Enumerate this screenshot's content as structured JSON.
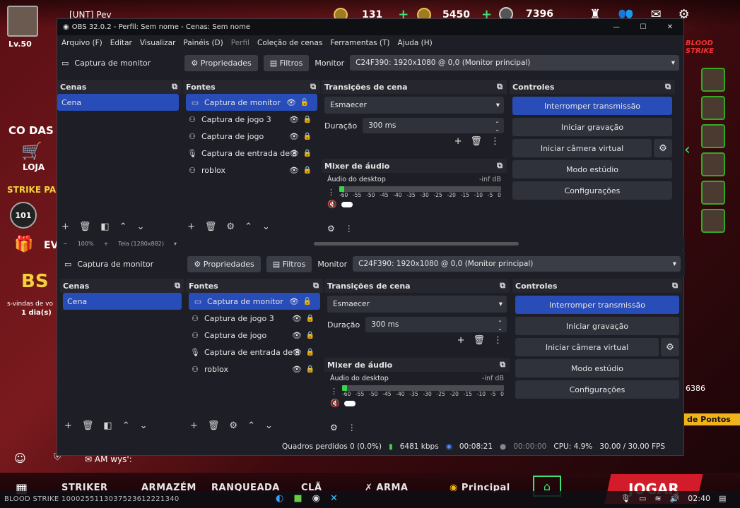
{
  "game": {
    "player_name": "[UNT] Pev",
    "level": "Lv.50",
    "stat1": "131",
    "stat2": "5450",
    "stat3": "7396",
    "left_labels": [
      "CO DAS",
      "LOJA",
      "STRIKE PA",
      "101",
      "EV"
    ],
    "event_text_1": "s-vindas de vo",
    "event_text_2": "1 dia(s)",
    "right_num": "6386",
    "right_points": "de Pontos",
    "blood_strikes_logo": "BLOOD STRIKE",
    "bottom_nav": [
      "STRIKER",
      "ARMAZÉM",
      "RANQUEADA",
      "CLÃ",
      "ARMA",
      "Principal"
    ],
    "jogar": "JOGAR",
    "uid_text": "BLOOD STRIKE 1000255113037523612221340",
    "chat_preview": "AM wys':",
    "clock": "02:40",
    "accent_red": "#d31c2a"
  },
  "obs": {
    "title": "OBS 32.0.2 - Perfil: Sem nome - Cenas: Sem nome",
    "menu": [
      "Arquivo (F)",
      "Editar",
      "Visualizar",
      "Painéis (D)",
      "Perfil",
      "Coleção de cenas",
      "Ferramentas (T)",
      "Ajuda (H)"
    ],
    "source_label": "Captura de monitor",
    "properties_btn": "Propriedades",
    "filters_btn": "Filtros",
    "monitor_label": "Monitor",
    "monitor_value": "C24F390: 1920x1080 @ 0,0 (Monitor principal)",
    "zoom_text": "100%",
    "canvas_text": "Tela (1280x882)",
    "scenes": {
      "title": "Cenas",
      "items": [
        "Cena"
      ]
    },
    "sources": {
      "title": "Fontes",
      "items": [
        "Captura de monitor",
        "Captura de jogo 3",
        "Captura de jogo",
        "Captura de entrada de á",
        "roblox"
      ]
    },
    "transitions": {
      "title": "Transições de cena",
      "type": "Esmaecer",
      "duration_label": "Duração",
      "duration_value": "300 ms"
    },
    "mixer": {
      "title": "Mixer de áudio",
      "channel": "Áudio do desktop",
      "level": "-inf dB",
      "ticks": [
        "-60",
        "-55",
        "-50",
        "-45",
        "-40",
        "-35",
        "-30",
        "-25",
        "-20",
        "-15",
        "-10",
        "-5",
        "0"
      ]
    },
    "controls": {
      "title": "Controles",
      "buttons": [
        "Interromper transmissão",
        "Iniciar gravação",
        "Iniciar câmera virtual",
        "Modo estúdio",
        "Configurações"
      ]
    },
    "status": {
      "dropped": "Quadros perdidos 0 (0.0%)",
      "bitrate": "6481 kbps",
      "stream_time": "00:08:21",
      "rec_time": "00:00:00",
      "cpu": "CPU: 4.9%",
      "fps": "30.00 / 30.00 FPS"
    },
    "accent_blue": "#284cb8"
  }
}
